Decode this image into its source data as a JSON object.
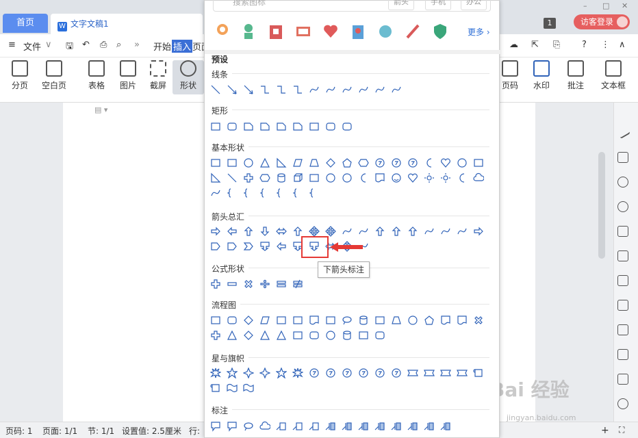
{
  "titlebar": {
    "home_tab": "首页",
    "doc_tab": "文字文稿1",
    "doc_icon": "W",
    "count_badge": "1",
    "login": "访客登录",
    "win_controls": [
      "–",
      "□",
      "✕"
    ]
  },
  "menubar": {
    "file": "文件",
    "start": "开始",
    "insert": "插入",
    "page_cut": "页面"
  },
  "ribbon": {
    "left": [
      "分页",
      "空白页",
      "表格",
      "图片",
      "截屏",
      "形状"
    ],
    "right": [
      "页码",
      "水印",
      "批注",
      "文本框"
    ]
  },
  "panel": {
    "search_placeholder": "搜索图标",
    "tags": [
      "箭头",
      "手机",
      "办公"
    ],
    "more": "更多",
    "preset": "预设",
    "categories": [
      "线条",
      "矩形",
      "基本形状",
      "箭头总汇",
      "公式形状",
      "流程图",
      "星与旗帜",
      "标注"
    ],
    "tooltip": "下箭头标注"
  },
  "statusbar": {
    "page_num": "页码: 1",
    "pages": "页面: 1/1",
    "section": "节: 1/1",
    "setting": "设置值: 2.5厘米",
    "row": "行:"
  },
  "watermark": {
    "brand": "Bai 经验",
    "site": "jingyan.baidu.com"
  },
  "colors": {
    "accent": "#3b6fd6",
    "login": "#e65f5f",
    "highlight": "#e53935"
  }
}
